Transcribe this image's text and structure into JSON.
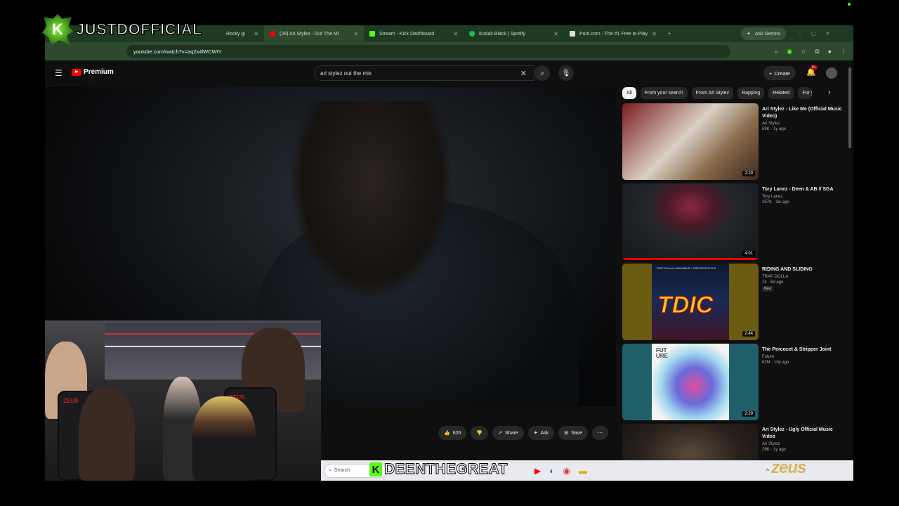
{
  "overlay": {
    "streamer_brand": "JUSTDOFFICIAL",
    "streamer_logo_letter": "K",
    "lower_name": "DEENTHEGREAT",
    "lower_logo_letter": "K",
    "sponsor": "zeus"
  },
  "browser": {
    "tabs": [
      {
        "label": "Rocky gi",
        "icon": "tab-icon"
      },
      {
        "label": "(28) Ari Stylez - Out The Mi",
        "icon": "youtube-icon",
        "active": true
      },
      {
        "label": "Stream - Kick Dashboard",
        "icon": "kick-icon"
      },
      {
        "label": "Kodak Black | Spotify",
        "icon": "spotify-icon"
      },
      {
        "label": "Punt.com - The #1 Free to Play",
        "icon": "punt-icon"
      }
    ],
    "new_tab": "+",
    "ask_gemini": "Ask Gemini",
    "url": "youtube.com/watch?v=aq2x4lWCWtY"
  },
  "youtube": {
    "brand": "Premium",
    "search_query": "ari stylez out the mix",
    "create_label": "Create",
    "notifications": "9+",
    "actions": {
      "likes": "626",
      "share": "Share",
      "ask": "Ask",
      "save": "Save"
    },
    "chips": [
      "All",
      "From your search",
      "From Ari Stylez",
      "Rapping",
      "Related",
      "For y"
    ],
    "recommendations": [
      {
        "title": "Ari Stylez - Like Me (Official Music Video)",
        "channel": "Ari Stylez",
        "stats": "59K · 1y ago",
        "duration": "2:29",
        "new": ""
      },
      {
        "title": "Tory Lanez - Deen & AB // SGA",
        "channel": "Tory Lanez",
        "stats": "257K · 3w ago",
        "duration": "4:01",
        "new": ""
      },
      {
        "title": "RIDING AND SLIDING",
        "channel": "TRAP DOLLA",
        "stats": "14 · 6d ago",
        "duration": "2:44",
        "new": "New"
      },
      {
        "title": "The Percocet & Stripper Joint",
        "channel": "Future",
        "stats": "62M · 10y ago",
        "duration": "2:29",
        "new": ""
      },
      {
        "title": "Ari Stylez - Ugly Official Music Video",
        "channel": "Ari Stylez",
        "stats": "29K · 1y ago",
        "duration": "",
        "new": ""
      }
    ],
    "thumb_texts": {
      "tdic_header": "TRAP DOLLA x IMMOBILE x CREATIVECELLS",
      "tdic": "TDIC",
      "future": "FUT URE"
    }
  },
  "taskbar": {
    "search_placeholder": "Search"
  },
  "webcam": {
    "chair_brand": "ZEUS"
  }
}
